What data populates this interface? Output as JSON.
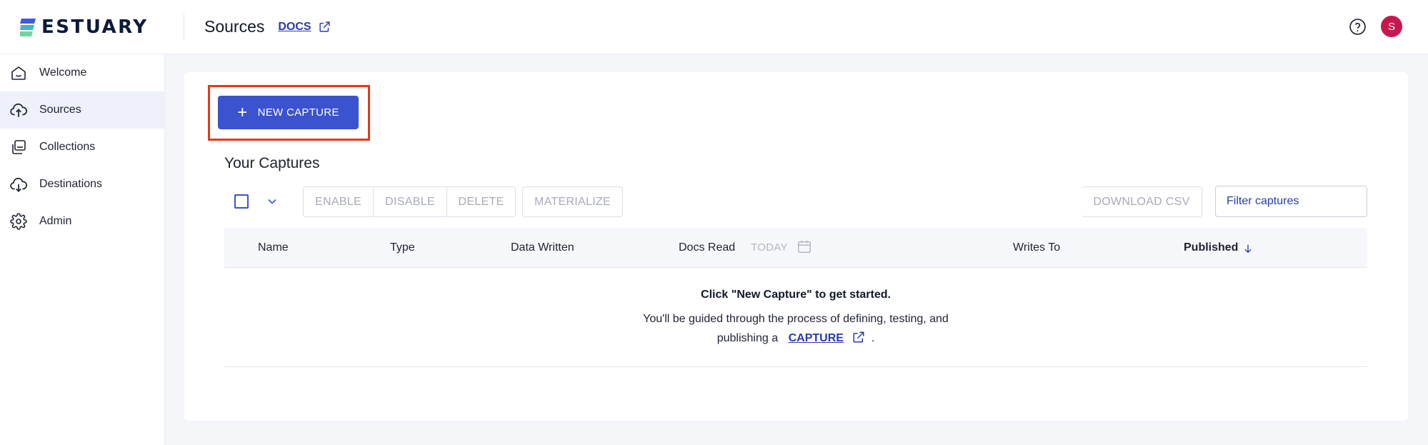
{
  "header": {
    "logo_text": "ESTUARY",
    "page_title": "Sources",
    "docs_label": "DOCS",
    "avatar_initial": "S"
  },
  "sidebar": {
    "items": [
      {
        "label": "Welcome",
        "icon": "home-icon"
      },
      {
        "label": "Sources",
        "icon": "cloud-upload-icon",
        "active": true
      },
      {
        "label": "Collections",
        "icon": "collections-icon"
      },
      {
        "label": "Destinations",
        "icon": "cloud-download-icon"
      },
      {
        "label": "Admin",
        "icon": "gear-icon"
      }
    ]
  },
  "main": {
    "new_capture_label": "NEW CAPTURE",
    "section_title": "Your Captures",
    "toolbar": {
      "enable": "ENABLE",
      "disable": "DISABLE",
      "delete": "DELETE",
      "materialize": "MATERIALIZE",
      "download_csv": "DOWNLOAD CSV",
      "filter_placeholder": "Filter captures"
    },
    "table": {
      "columns": {
        "name": "Name",
        "type": "Type",
        "data_written": "Data Written",
        "docs_read": "Docs Read",
        "today": "TODAY",
        "writes_to": "Writes To",
        "published": "Published"
      }
    },
    "empty_state": {
      "title": "Click \"New Capture\" to get started.",
      "line1": "You'll be guided through the process of defining, testing, and",
      "line2_prefix": "publishing a",
      "link": "CAPTURE",
      "line2_suffix": "."
    }
  },
  "colors": {
    "accent": "#3b53cf",
    "link": "#2a3aa8",
    "highlight": "#e9361b",
    "avatar": "#c8174f"
  }
}
